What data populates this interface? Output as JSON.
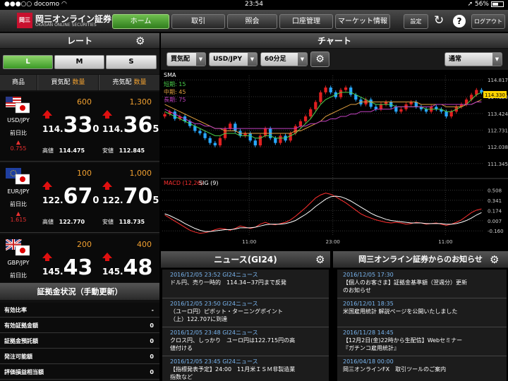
{
  "status_bar": {
    "carrier": "docomo",
    "time": "23:54",
    "battery": "56%"
  },
  "logo": {
    "mark": "岡三",
    "name": "岡三オンライン証券",
    "name_en": "OKASAN ONLINE SECURITIES"
  },
  "nav": {
    "home": "ホーム",
    "trade": "取引",
    "inquiry": "照会",
    "account": "口座管理",
    "market": "マーケット情報",
    "settings": "設定",
    "help": "?",
    "logout": "ログアウト"
  },
  "rate_panel": {
    "title": "レート",
    "size_tabs": [
      "L",
      "M",
      "S"
    ],
    "selected_tab": "L",
    "col_product": "商品",
    "col_buy": "買気配",
    "col_sell": "売気配",
    "col_amount": "数量",
    "change_label": "前日比",
    "high_label": "高値",
    "low_label": "安値",
    "pairs": [
      {
        "name": "USD/JPY",
        "change": "0.755",
        "bid_amount": "600",
        "ask_amount": "1,300",
        "bid_pre": "114.",
        "bid_big": "33",
        "bid_last": "0",
        "ask_pre": "114.",
        "ask_big": "36",
        "ask_last": "5",
        "high": "114.475",
        "low": "112.845"
      },
      {
        "name": "EUR/JPY",
        "change": "1.615",
        "bid_amount": "100",
        "ask_amount": "1,000",
        "bid_pre": "122.",
        "bid_big": "67",
        "bid_last": "0",
        "ask_pre": "122.",
        "ask_big": "70",
        "ask_last": "5",
        "high": "122.770",
        "low": "118.735"
      },
      {
        "name": "GBP/JPY",
        "change": "",
        "bid_amount": "200",
        "ask_amount": "400",
        "bid_pre": "145.",
        "bid_big": "43",
        "bid_last": "",
        "ask_pre": "145.",
        "ask_big": "48",
        "ask_last": ""
      }
    ]
  },
  "margin": {
    "title": "証拠金状況（手動更新）",
    "rows": [
      {
        "label": "有効比率",
        "value": "-"
      },
      {
        "label": "有効証拠金額",
        "value": "0"
      },
      {
        "label": "証拠金預託額",
        "value": "0"
      },
      {
        "label": "発注可能額",
        "value": "0"
      },
      {
        "label": "評価損益相当額",
        "value": "0"
      }
    ]
  },
  "chart_panel": {
    "title": "チャート",
    "price_type": "買気配",
    "pair": "USD/JPY",
    "interval": "60分足",
    "mode": "通常",
    "sma_label": "SMA",
    "sma_short": "短期: 15",
    "sma_mid": "中期: 45",
    "sma_long": "長期: 75",
    "macd_label": "MACD (12,26)",
    "sig_label": "SIG (9)",
    "current_price": "114.330",
    "colors": {
      "short": "#4cd24c",
      "mid": "#e0a040",
      "long": "#c040c0",
      "macd": "#ff3030",
      "sig": "#ffffff"
    }
  },
  "chart_data": [
    {
      "type": "candlestick",
      "title": "SMA",
      "x_ticks": [
        "11:00",
        "23:00",
        "11:00"
      ],
      "y_ticks": [
        114.817,
        114.12,
        113.424,
        112.731,
        112.038,
        111.345
      ],
      "ylim": [
        110.9,
        115.0
      ],
      "close": [
        113.4,
        113.5,
        113.2,
        113.3,
        113.1,
        112.9,
        112.7,
        112.6,
        112.4,
        112.2,
        112.1,
        112.4,
        112.8,
        113.0,
        112.7,
        112.5,
        112.6,
        112.3,
        112.1,
        112.5,
        112.8,
        112.4,
        112.2,
        112.5,
        112.3,
        112.6,
        112.9,
        113.1,
        113.3,
        113.6,
        113.9,
        114.3,
        114.5,
        114.3,
        114.1,
        114.4,
        114.5,
        114.2,
        114.0,
        113.8,
        114.0,
        113.7,
        113.6,
        113.8,
        113.9,
        113.7,
        113.5,
        113.6,
        113.8,
        113.9,
        113.7,
        113.6,
        113.5,
        113.7,
        113.6,
        113.5,
        113.3,
        113.5,
        113.7,
        113.8,
        114.0,
        114.2,
        114.4,
        114.3
      ],
      "series": [
        {
          "name": "短期: 15",
          "values": [
            113.5,
            113.4,
            113.3,
            113.2,
            113.1,
            113.0,
            112.9,
            112.8,
            112.7,
            112.6,
            112.5,
            112.5,
            112.6,
            112.6,
            112.6,
            112.5,
            112.5,
            112.5,
            112.4,
            112.4,
            112.5,
            112.5,
            112.4,
            112.4,
            112.4,
            112.5,
            112.6,
            112.8,
            113.0,
            113.2,
            113.5,
            113.8,
            114.0,
            114.1,
            114.2,
            114.3,
            114.3,
            114.3,
            114.2,
            114.1,
            114.0,
            113.9,
            113.8,
            113.8,
            113.8,
            113.8,
            113.7,
            113.7,
            113.7,
            113.7,
            113.7,
            113.7,
            113.6,
            113.6,
            113.6,
            113.6,
            113.5,
            113.5,
            113.6,
            113.7,
            113.8,
            114.0,
            114.2,
            114.3
          ]
        },
        {
          "name": "中期: 45",
          "values": [
            113.8,
            113.7,
            113.6,
            113.5,
            113.4,
            113.3,
            113.2,
            113.1,
            113.0,
            112.9,
            112.8,
            112.8,
            112.7,
            112.7,
            112.7,
            112.6,
            112.6,
            112.6,
            112.6,
            112.6,
            112.6,
            112.6,
            112.6,
            112.6,
            112.6,
            112.6,
            112.7,
            112.7,
            112.8,
            112.9,
            113.0,
            113.1,
            113.3,
            113.4,
            113.5,
            113.6,
            113.7,
            113.8,
            113.8,
            113.9,
            113.9,
            113.9,
            113.9,
            113.9,
            113.9,
            113.9,
            113.9,
            113.9,
            113.9,
            113.9,
            113.9,
            113.8,
            113.8,
            113.8,
            113.8,
            113.8,
            113.7,
            113.7,
            113.7,
            113.7,
            113.8,
            113.8,
            113.9,
            114.0
          ]
        },
        {
          "name": "長期: 75",
          "values": [
            113.6,
            113.5,
            113.4,
            113.3,
            113.2,
            113.1,
            113.0,
            113.0,
            112.9,
            112.9,
            112.8,
            112.8,
            112.8,
            112.8,
            112.8,
            112.8,
            112.8,
            112.8,
            112.8,
            112.8,
            112.8,
            112.8,
            112.8,
            112.8,
            112.8,
            112.8,
            112.8,
            112.9,
            112.9,
            113.0,
            113.0,
            113.1,
            113.1,
            113.2,
            113.2,
            113.3,
            113.3,
            113.4,
            113.4,
            113.5,
            113.5,
            113.5,
            113.6,
            113.6,
            113.6,
            113.6,
            113.7,
            113.7,
            113.7,
            113.7,
            113.7,
            113.7,
            113.7,
            113.7,
            113.8,
            113.8,
            113.8,
            113.8,
            113.8,
            113.8,
            113.8,
            113.8,
            113.9,
            113.9
          ]
        }
      ]
    },
    {
      "type": "line",
      "title": "MACD (12,26)",
      "y_ticks": [
        0.508,
        0.341,
        0.174,
        0.007,
        -0.16
      ],
      "ylim": [
        -0.25,
        0.56
      ],
      "series": [
        {
          "name": "MACD (12,26)",
          "values": [
            0.1,
            0.05,
            0.0,
            -0.05,
            -0.1,
            -0.15,
            -0.18,
            -0.2,
            -0.19,
            -0.17,
            -0.14,
            -0.12,
            -0.13,
            -0.15,
            -0.12,
            -0.08,
            -0.1,
            -0.12,
            -0.1,
            -0.05,
            -0.02,
            -0.05,
            -0.06,
            -0.04,
            -0.02,
            0.02,
            0.08,
            0.15,
            0.22,
            0.3,
            0.38,
            0.43,
            0.46,
            0.44,
            0.4,
            0.35,
            0.3,
            0.24,
            0.18,
            0.12,
            0.08,
            0.05,
            0.02,
            0.0,
            -0.02,
            -0.03,
            -0.02,
            -0.03,
            -0.05,
            -0.04,
            -0.02,
            -0.03,
            -0.05,
            -0.04,
            -0.03,
            -0.05,
            -0.07,
            -0.05,
            -0.02,
            0.02,
            0.08,
            0.14,
            0.18,
            0.2
          ]
        },
        {
          "name": "SIG (9)",
          "values": [
            0.12,
            0.09,
            0.05,
            0.01,
            -0.04,
            -0.08,
            -0.12,
            -0.15,
            -0.17,
            -0.17,
            -0.16,
            -0.15,
            -0.14,
            -0.14,
            -0.13,
            -0.11,
            -0.11,
            -0.11,
            -0.1,
            -0.08,
            -0.06,
            -0.05,
            -0.05,
            -0.05,
            -0.04,
            -0.02,
            0.01,
            0.06,
            0.11,
            0.17,
            0.24,
            0.3,
            0.36,
            0.4,
            0.41,
            0.4,
            0.37,
            0.33,
            0.28,
            0.23,
            0.18,
            0.13,
            0.09,
            0.06,
            0.03,
            0.01,
            0.0,
            -0.01,
            -0.02,
            -0.03,
            -0.03,
            -0.03,
            -0.04,
            -0.04,
            -0.04,
            -0.04,
            -0.05,
            -0.05,
            -0.04,
            -0.02,
            0.01,
            0.05,
            0.1,
            0.14
          ]
        }
      ]
    }
  ],
  "news": {
    "title": "ニュース(GI24)",
    "items": [
      {
        "date": "2016/12/05 23:52 GI24ニュース",
        "line1": "ドル円、売り一時的　114.34−37円まで反発",
        "line2": "",
        "line3": ""
      },
      {
        "date": "2016/12/05 23:50 GI24ニュース",
        "line1": "（ユーロ円）ピボット・ターニングポイント",
        "line2": "（上）122.707に到達",
        "line3": ""
      },
      {
        "date": "2016/12/05 23:48 GI24ニュース",
        "line1": "クロス円、しっかり　ユーロ円は122.715円の高",
        "line2": "値付ける",
        "line3": ""
      },
      {
        "date": "2016/12/05 23:45 GI24ニュース",
        "line1": "【指標発表予定】24:00　11月米ＩＳＭ非製造業",
        "line2": "指数など",
        "line3": ""
      }
    ]
  },
  "notices": {
    "title": "岡三オンライン証券からのお知らせ",
    "items": [
      {
        "date": "2016/12/05 17:30",
        "line1": "【個人のお客さま】証拠金基準額（翌週分）更新",
        "line2": "のお知らせ"
      },
      {
        "date": "2016/12/01 18:35",
        "line1": "米国雇用統計 解説ページを公開いたしました",
        "line2": ""
      },
      {
        "date": "2016/11/28 14:45",
        "line1": "【12月2日(金)22時から生配信】Webセミナー",
        "line2": "『ガチンコ雇用統計』"
      },
      {
        "date": "2016/04/18 00:00",
        "line1": "岡三オンラインFX　取引ツールのご案内",
        "line2": ""
      }
    ]
  }
}
